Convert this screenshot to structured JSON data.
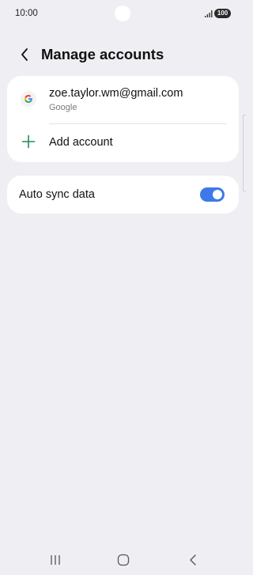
{
  "status_bar": {
    "time": "10:00",
    "battery": "100",
    "icons": [
      "signal-icon",
      "battery-icon"
    ]
  },
  "header": {
    "title": "Manage accounts",
    "back_icon": "chevron-left-icon"
  },
  "accounts": [
    {
      "email": "zoe.taylor.wm@gmail.com",
      "provider": "Google",
      "icon": "google-icon"
    }
  ],
  "add_account": {
    "label": "Add account",
    "icon": "plus-icon"
  },
  "auto_sync": {
    "label": "Auto sync data",
    "enabled": true
  },
  "nav_bar": {
    "icons": [
      "recent-apps-icon",
      "home-icon",
      "back-icon"
    ]
  },
  "colors": {
    "background": "#efeff3",
    "card": "#ffffff",
    "accent": "#3e79e8",
    "add_icon": "#1e8c5a"
  }
}
